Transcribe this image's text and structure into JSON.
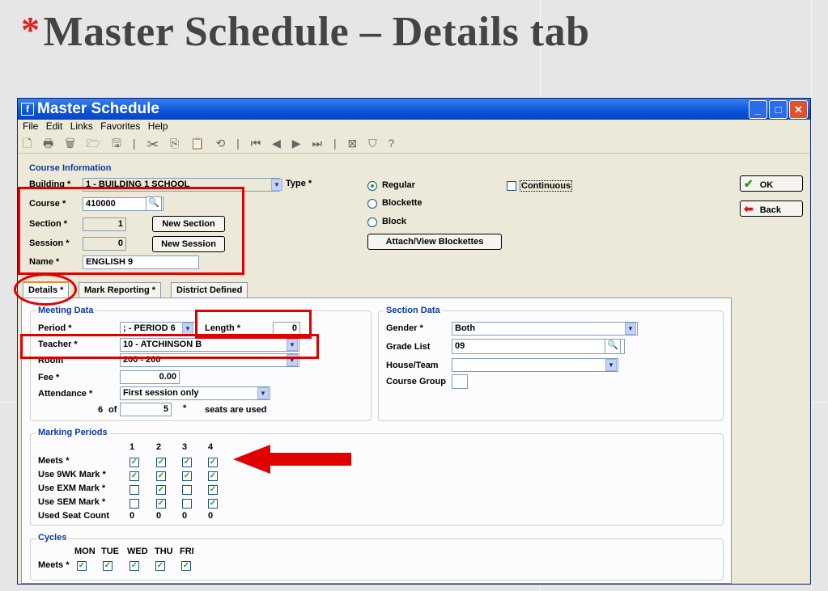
{
  "slide": {
    "bullet": "*",
    "title": "Master Schedule – Details tab"
  },
  "window": {
    "title": "Master Schedule",
    "app_icon": "f",
    "min": "_",
    "max": "□",
    "close": "✕"
  },
  "menu": [
    "File",
    "Edit",
    "Links",
    "Favorites",
    "Help"
  ],
  "toolbar": {
    "icons": "🗋 🖶 🗑 🗁 🖫 | ✂ ⎘ 📋 ⟲ | ⏮ ◀ ▶ ⏭ | ⊠ ⛉ ?"
  },
  "course_info": {
    "group": "Course Information",
    "building_label": "Building *",
    "building_value": "1 - BUILDING 1 SCHOOL",
    "type_label": "Type *",
    "course_label": "Course *",
    "course_value": "410000",
    "section_label": "Section *",
    "section_value": "1",
    "new_section": "New Section",
    "session_label": "Session *",
    "session_value": "0",
    "new_session": "New Session",
    "name_label": "Name *",
    "name_value": "ENGLISH 9",
    "type_regular": "Regular",
    "type_blockette": "Blockette",
    "type_block": "Block",
    "continuous": "Continuous",
    "attach": "Attach/View Blockettes"
  },
  "buttons": {
    "ok": "OK",
    "back": "Back"
  },
  "tabs": [
    "Details *",
    "Mark Reporting *",
    "District Defined"
  ],
  "meeting": {
    "group": "Meeting Data",
    "period_label": "Period *",
    "period_value": "; - PERIOD 6",
    "length_label": "Length *",
    "length_value": "0",
    "teacher_label": "Teacher *",
    "teacher_value": "10 - ATCHINSON B",
    "room_label": "Room",
    "room_value": "200 - 200",
    "fee_label": "Fee *",
    "fee_value": "0.00",
    "attendance_label": "Attendance *",
    "attendance_value": "First session only",
    "seats_count": "6",
    "seats_of": "of",
    "seats_value": "5",
    "seats_star": "*",
    "seats_text": "seats are used"
  },
  "section_data": {
    "group": "Section Data",
    "gender_label": "Gender *",
    "gender_value": "Both",
    "grade_label": "Grade List",
    "grade_value": "09",
    "house_label": "House/Team",
    "house_value": "",
    "course_group_label": "Course Group"
  },
  "marking": {
    "group": "Marking Periods",
    "columns": [
      "1",
      "2",
      "3",
      "4"
    ],
    "rows": [
      {
        "label": "Meets *",
        "checks": [
          true,
          true,
          true,
          true
        ]
      },
      {
        "label": "Use  9WK  Mark *",
        "checks": [
          true,
          true,
          true,
          true
        ]
      },
      {
        "label": "Use  EXM  Mark *",
        "checks": [
          false,
          true,
          false,
          true
        ]
      },
      {
        "label": "Use  SEM  Mark *",
        "checks": [
          false,
          true,
          false,
          true
        ]
      }
    ],
    "seat_label": "Used Seat Count",
    "seat_values": [
      "0",
      "0",
      "0",
      "0"
    ]
  },
  "cycles": {
    "group": "Cycles",
    "days": [
      "MON",
      "TUE",
      "WED",
      "THU",
      "FRI"
    ],
    "meets_label": "Meets *",
    "checks": [
      true,
      true,
      true,
      true,
      true
    ]
  },
  "colors": {
    "annotation": "#e00000",
    "title_bar": "#0a52d8",
    "group_label": "#0b3a9e"
  }
}
